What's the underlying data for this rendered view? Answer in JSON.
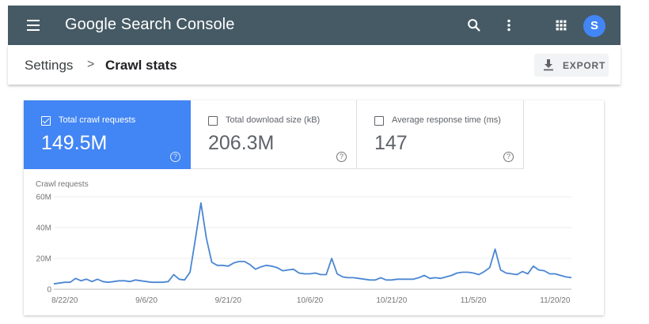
{
  "app": {
    "brand": "Google Search Console",
    "avatar_letter": "S",
    "avatar_color": "#4285f4",
    "topbar_color": "#455a64"
  },
  "header_icons": [
    "menu-icon",
    "search-icon",
    "more-vert-icon",
    "apps-icon"
  ],
  "breadcrumb": {
    "parent": "Settings",
    "separator": ">",
    "current": "Crawl stats"
  },
  "export": {
    "label": "EXPORT",
    "icon": "download-icon"
  },
  "metrics": [
    {
      "label": "Total crawl requests",
      "value": "149.5M",
      "checked": true,
      "accent": "#4285f4"
    },
    {
      "label": "Total download size (kB)",
      "value": "206.3M",
      "checked": false
    },
    {
      "label": "Average response time (ms)",
      "value": "147",
      "checked": false
    }
  ],
  "chart_data": {
    "type": "line",
    "title": "Crawl requests",
    "xlabel": "",
    "ylabel": "",
    "ylim": [
      0,
      60
    ],
    "y_ticks": [
      "0",
      "20M",
      "40M",
      "60M"
    ],
    "x_ticks": [
      "8/22/20",
      "9/6/20",
      "9/21/20",
      "10/6/20",
      "10/21/20",
      "11/5/20",
      "11/20/20"
    ],
    "x_tick_positions": [
      2,
      17,
      32,
      47,
      62,
      77,
      92
    ],
    "grid": true,
    "series": [
      {
        "color": "#4a86d3",
        "values": [
          3.5,
          4,
          4.5,
          4.5,
          7,
          5.5,
          6.5,
          5,
          6.5,
          5,
          4.5,
          5,
          5.5,
          5.5,
          5,
          6,
          5.5,
          5,
          4.5,
          4.5,
          4.5,
          5,
          9.5,
          6.5,
          6,
          11,
          33,
          56,
          33,
          17.5,
          15.5,
          15.5,
          15,
          17,
          18,
          18,
          16,
          13,
          14.5,
          15.5,
          15,
          14,
          12,
          12.5,
          13,
          10.5,
          10,
          10,
          10.5,
          9.5,
          9.5,
          20,
          10,
          8,
          7.5,
          7.5,
          7,
          6.5,
          6,
          6,
          7.5,
          6,
          6,
          6.5,
          6.5,
          6.5,
          6.5,
          7.5,
          9,
          7,
          7.5,
          7,
          8,
          9,
          10.5,
          11,
          11,
          10.5,
          9.5,
          11.5,
          14,
          26,
          12.5,
          10.5,
          10,
          9.5,
          11.5,
          10,
          15,
          12.5,
          12,
          10,
          10,
          9,
          8,
          7.5
        ]
      }
    ]
  }
}
